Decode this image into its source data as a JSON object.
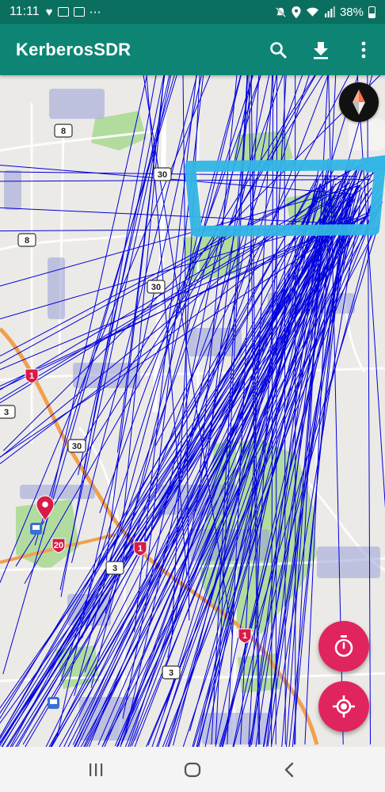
{
  "status_bar": {
    "time": "11:11",
    "notification_icons": [
      "heart-icon",
      "mail-icon",
      "mail-icon",
      "more-dots-icon"
    ],
    "system_icons": [
      "mute-icon",
      "location-icon",
      "wifi-icon",
      "signal-icon"
    ],
    "battery_text": "38%",
    "battery_level": 0.38
  },
  "app_bar": {
    "title": "KerberosSDR",
    "actions": [
      "search-icon",
      "download-icon",
      "overflow-menu-icon"
    ]
  },
  "map": {
    "route_shields": [
      "8",
      "30",
      "8",
      "30",
      "1",
      "3",
      "30",
      "20",
      "1",
      "3",
      "1",
      "3"
    ],
    "compass_icon": "compass-icon",
    "marker_icon": "map-pin-icon",
    "bearing_line_color": "#0000dd",
    "highway_color": "#f0a050",
    "park_color": "#a8d990",
    "highlight_box_color": "#33b5e5"
  },
  "fabs": {
    "timer": "timer-icon",
    "locate": "my-location-icon",
    "color": "#e0245e"
  },
  "nav_bar": {
    "buttons": [
      "recent-apps-icon",
      "home-icon",
      "back-icon"
    ]
  }
}
